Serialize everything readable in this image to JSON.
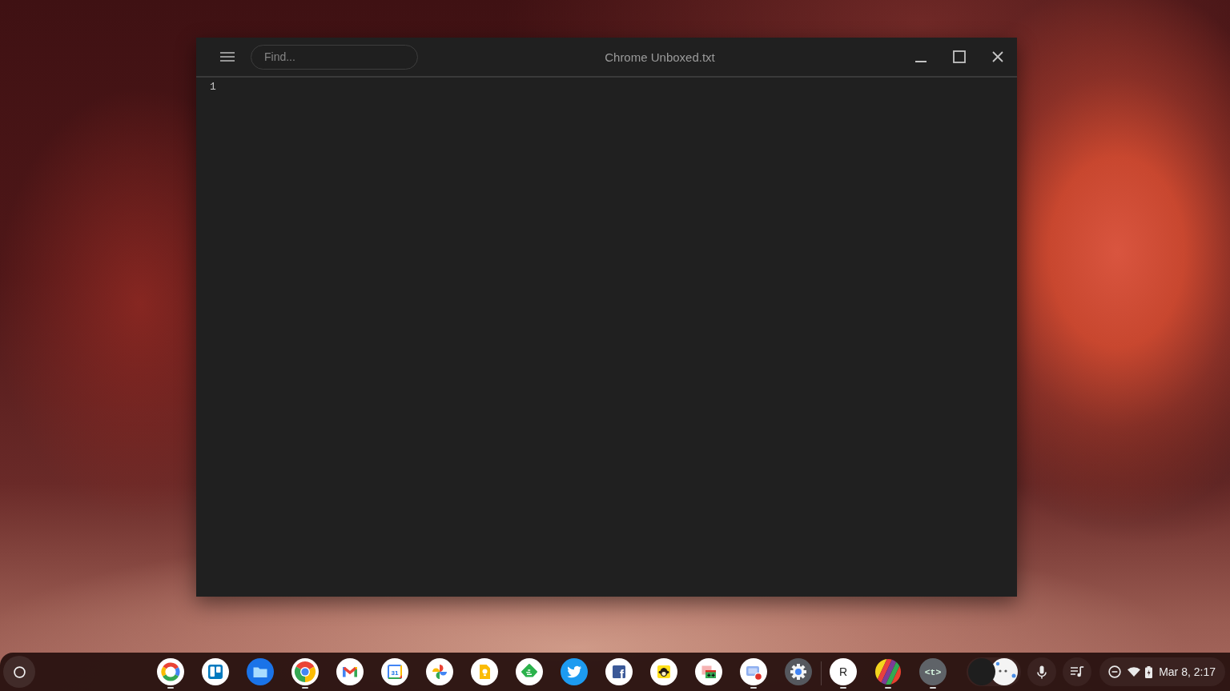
{
  "window": {
    "title": "Chrome Unboxed.txt",
    "find": {
      "placeholder": "Find..."
    },
    "line_numbers": [
      "1"
    ]
  },
  "shelf": {
    "pinned_apps": [
      {
        "kind": "ring",
        "running": true
      },
      {
        "kind": "board",
        "running": false
      },
      {
        "kind": "folder",
        "running": false
      },
      {
        "kind": "wheel",
        "running": true
      },
      {
        "kind": "mail",
        "running": false
      },
      {
        "kind": "calendar",
        "glyph": "31",
        "running": false
      },
      {
        "kind": "pinwheel",
        "running": false
      },
      {
        "kind": "document",
        "running": false
      },
      {
        "kind": "feed",
        "running": false
      },
      {
        "kind": "bird",
        "running": false
      },
      {
        "kind": "letter",
        "glyph": "f",
        "running": false
      },
      {
        "kind": "monkey",
        "running": false
      },
      {
        "kind": "sheet",
        "running": false
      },
      {
        "kind": "recorder",
        "running": true
      },
      {
        "kind": "gear",
        "running": false
      }
    ],
    "unpinned_apps": [
      {
        "kind": "letter_disc",
        "glyph": "R",
        "running": true
      },
      {
        "kind": "stripes",
        "running": true
      },
      {
        "kind": "code",
        "glyph": "<t>",
        "running": true
      }
    ],
    "date_time": "Mar 8, 2:17"
  }
}
